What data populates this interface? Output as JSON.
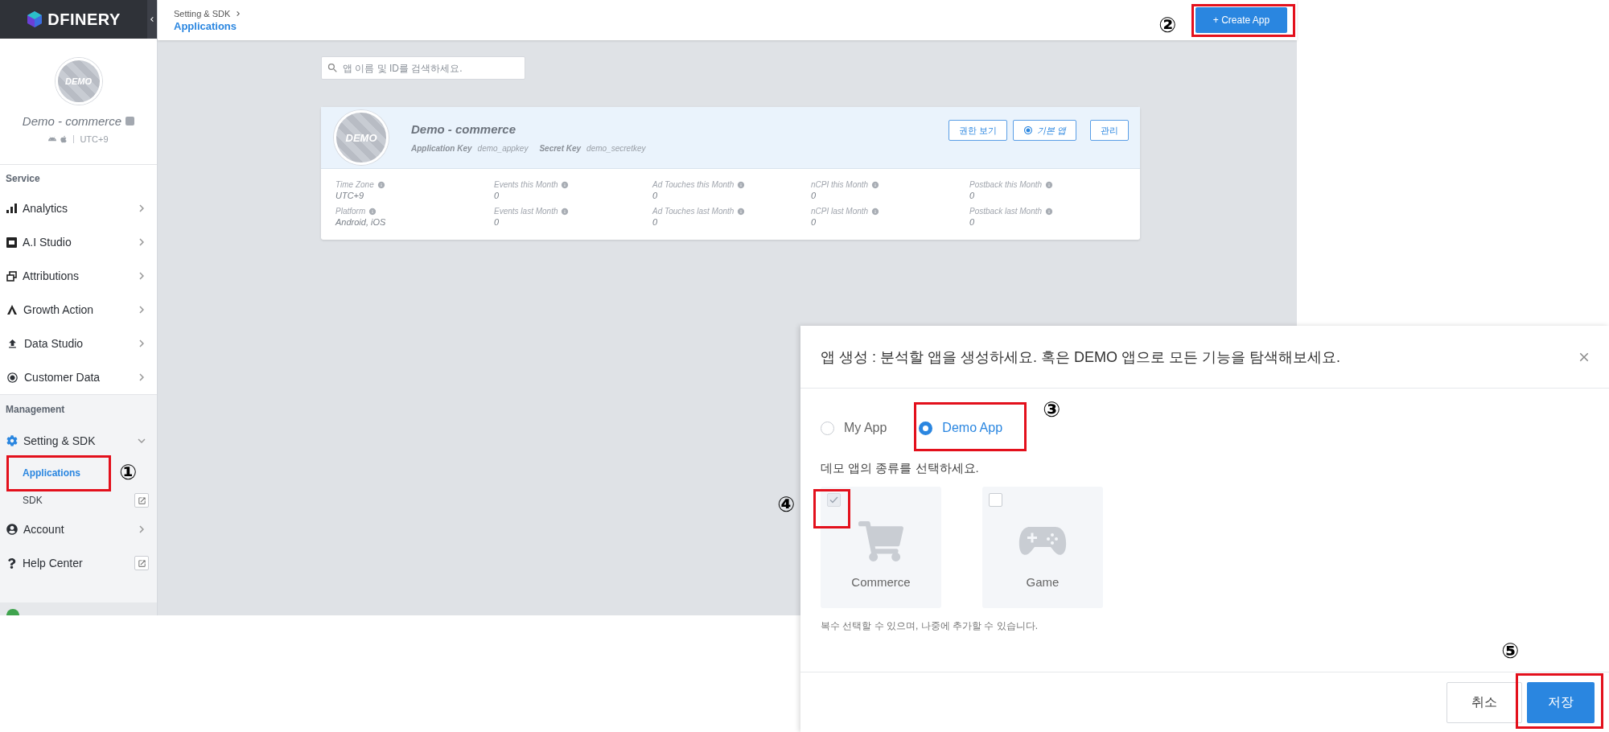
{
  "sidebar": {
    "logo": "DFINERY",
    "profile": {
      "avatar_text": "DEMO",
      "name": "Demo - commerce",
      "timezone": "UTC+9"
    },
    "sections": [
      {
        "title": "Service",
        "items": [
          {
            "label": "Analytics",
            "kind": "menu",
            "expanded": false
          },
          {
            "label": "A.I Studio",
            "kind": "menu",
            "expanded": false
          },
          {
            "label": "Attributions",
            "kind": "menu",
            "expanded": false
          },
          {
            "label": "Growth Action",
            "kind": "menu",
            "expanded": false
          },
          {
            "label": "Data Studio",
            "kind": "menu",
            "expanded": false
          },
          {
            "label": "Customer Data",
            "kind": "menu",
            "expanded": false
          }
        ]
      },
      {
        "title": "Management",
        "items": [
          {
            "label": "Setting & SDK",
            "kind": "menu",
            "expanded": true,
            "children": [
              {
                "label": "Applications",
                "kind": "link",
                "selected": true
              },
              {
                "label": "SDK",
                "kind": "external",
                "selected": false
              }
            ]
          },
          {
            "label": "Account",
            "kind": "menu",
            "expanded": false
          },
          {
            "label": "Help Center",
            "kind": "external"
          }
        ]
      }
    ]
  },
  "header": {
    "breadcrumb": [
      "Setting & SDK"
    ],
    "title": "Applications",
    "create_button": "+ Create App"
  },
  "search": {
    "placeholder": "앱 이름 및 ID를 검색하세요."
  },
  "app_card": {
    "avatar_text": "DEMO",
    "name": "Demo - commerce",
    "keys": [
      {
        "label": "Application Key",
        "value": "demo_appkey"
      },
      {
        "label": "Secret Key",
        "value": "demo_secretkey"
      }
    ],
    "buttons": [
      {
        "label": "권한 보기",
        "kind": "plain"
      },
      {
        "label": "기본 앱",
        "kind": "default"
      },
      {
        "label": "관리",
        "kind": "plain"
      }
    ],
    "stats": [
      {
        "label": "Time Zone",
        "value": "UTC+9"
      },
      {
        "label": "Events this Month",
        "value": "0"
      },
      {
        "label": "Ad Touches this Month",
        "value": "0"
      },
      {
        "label": "nCPI this Month",
        "value": "0"
      },
      {
        "label": "Postback this Month",
        "value": "0"
      },
      {
        "label": "Platform",
        "value": "Android, iOS"
      },
      {
        "label": "Events last Month",
        "value": "0"
      },
      {
        "label": "Ad Touches last Month",
        "value": "0"
      },
      {
        "label": "nCPI last Month",
        "value": "0"
      },
      {
        "label": "Postback last Month",
        "value": "0"
      }
    ]
  },
  "modal": {
    "title": "앱 생성 : 분석할 앱을 생성하세요. 혹은 DEMO 앱으로 모든 기능을 탐색해보세요.",
    "options": [
      {
        "label": "My App",
        "selected": false
      },
      {
        "label": "Demo App",
        "selected": true
      }
    ],
    "subtitle": "데모 앱의 종류를 선택하세요.",
    "types": [
      {
        "label": "Commerce",
        "checked": true
      },
      {
        "label": "Game",
        "checked": false
      }
    ],
    "hint": "복수 선택할 수 있으며, 나중에 추가할 수 있습니다.",
    "buttons": [
      {
        "label": "취소",
        "kind": "secondary"
      },
      {
        "label": "저장",
        "kind": "primary"
      }
    ]
  },
  "annotations": [
    {
      "label": "①"
    },
    {
      "label": "②"
    },
    {
      "label": "③"
    },
    {
      "label": "④"
    },
    {
      "label": "⑤"
    }
  ]
}
